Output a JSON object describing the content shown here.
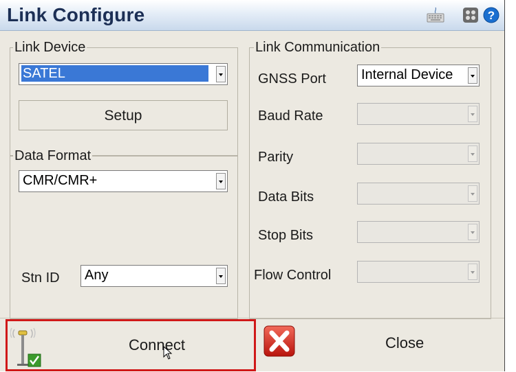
{
  "window": {
    "title": "Link Configure",
    "icons": [
      "keyboard-icon",
      "app-switch-icon",
      "help-icon"
    ],
    "help_glyph": "?"
  },
  "link_device": {
    "legend": "Link Device",
    "device": "SATEL",
    "setup_label": "Setup"
  },
  "data_format": {
    "legend": "Data Format",
    "format": "CMR/CMR+",
    "stn_id_label": "Stn ID",
    "stn_id": "Any"
  },
  "link_comm": {
    "legend": "Link Communication",
    "gnss_port_label": "GNSS Port",
    "gnss_port": "Internal Device",
    "baud_rate_label": "Baud Rate",
    "parity_label": "Parity",
    "data_bits_label": "Data Bits",
    "stop_bits_label": "Stop Bits",
    "flow_control_label": "Flow Control"
  },
  "actions": {
    "connect_label": "Connect",
    "close_label": "Close"
  },
  "colors": {
    "title_text": "#1c2f55",
    "selection": "#3a78d6",
    "connect_highlight": "#d01818",
    "close_red": "#d9261c"
  }
}
